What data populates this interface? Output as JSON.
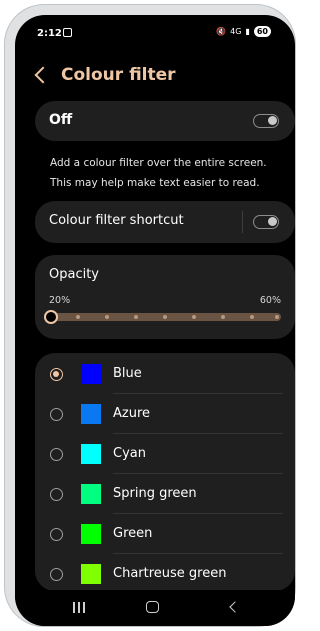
{
  "status": {
    "time": "2:12",
    "battery": "60",
    "network": "4G"
  },
  "header": {
    "title": "Colour filter"
  },
  "main_toggle": {
    "label": "Off",
    "state": "off"
  },
  "description": "Add a colour filter over the entire screen. This may help make text easier to read.",
  "shortcut": {
    "label": "Colour filter shortcut",
    "state": "off"
  },
  "opacity": {
    "label": "Opacity",
    "min_label": "20%",
    "max_label": "60%",
    "value": 0
  },
  "colors": [
    {
      "name": "Blue",
      "swatch": "#0000ff",
      "selected": true
    },
    {
      "name": "Azure",
      "swatch": "#0a78f0",
      "selected": false
    },
    {
      "name": "Cyan",
      "swatch": "#00ffff",
      "selected": false
    },
    {
      "name": "Spring green",
      "swatch": "#00ff80",
      "selected": false
    },
    {
      "name": "Green",
      "swatch": "#00ff00",
      "selected": false
    },
    {
      "name": "Chartreuse green",
      "swatch": "#80ff00",
      "selected": false
    }
  ],
  "accent": "#f0c7a4"
}
